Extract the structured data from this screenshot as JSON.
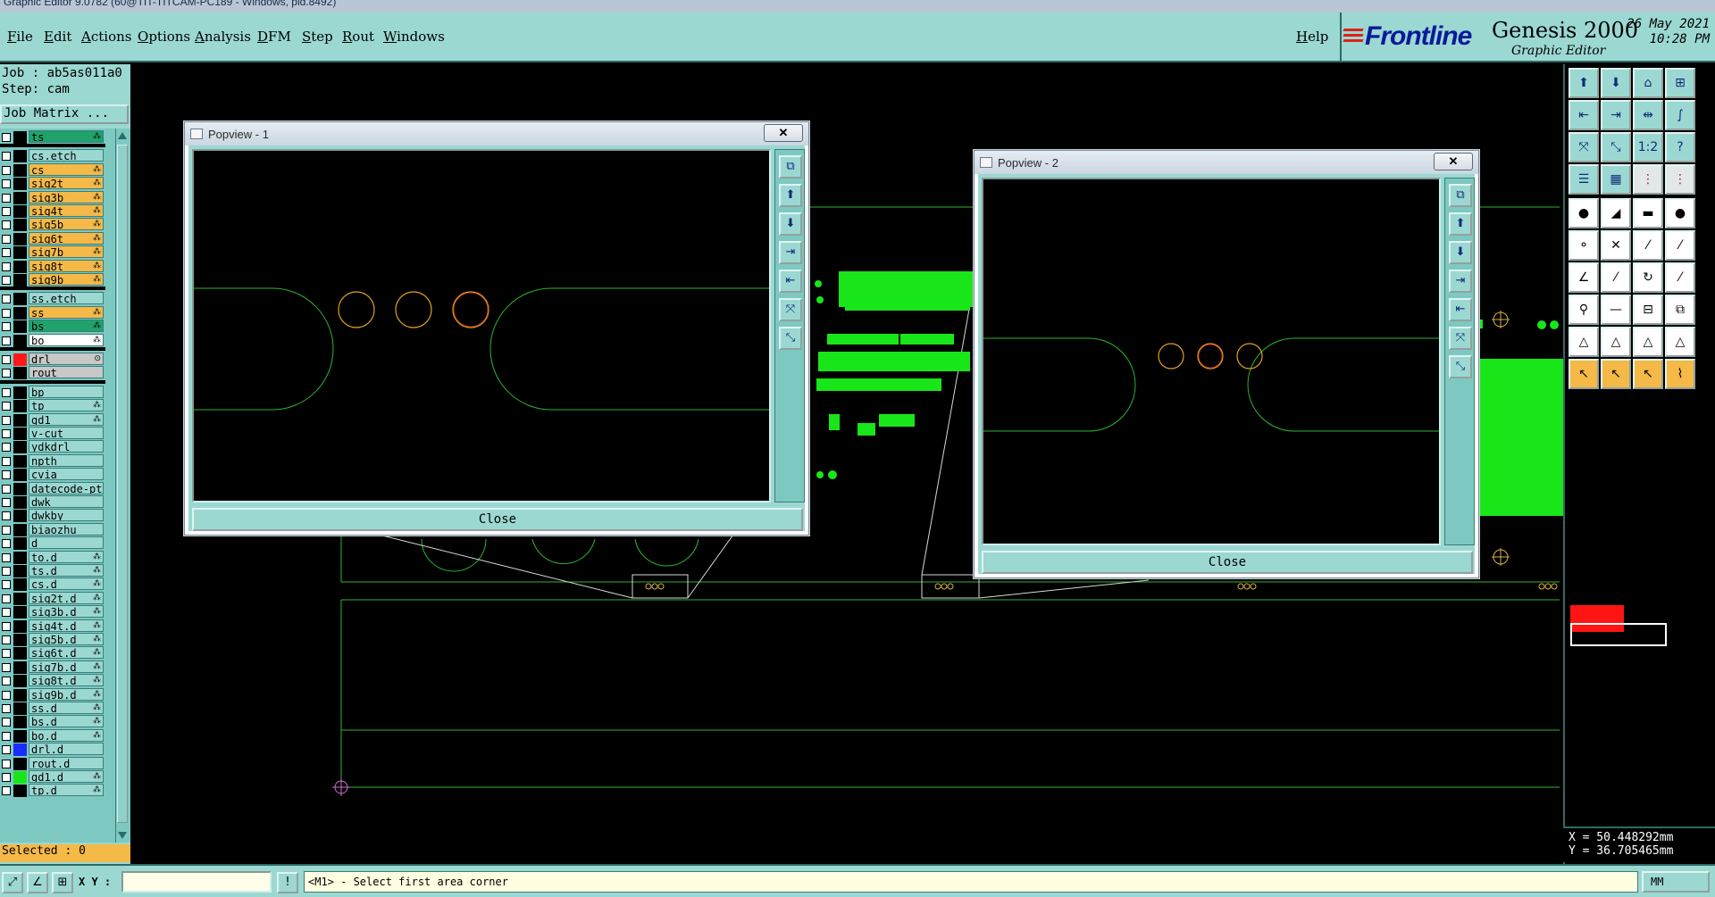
{
  "window_title": "Graphic Editor 9.0782 (60@TIT-TITCAM-PC189 - Windows, pid.8492)",
  "menu": {
    "items": [
      "File",
      "Edit",
      "Actions",
      "Options",
      "Analysis",
      "DFM",
      "Step",
      "Rout",
      "Windows"
    ],
    "help": "Help"
  },
  "brand": {
    "logo": "Frontline",
    "product": "Genesis 2000",
    "subtitle": "Graphic Editor",
    "date": "26 May 2021",
    "time": "10:28 PM"
  },
  "left_panel": {
    "job": "Job : ab5as011a0",
    "step": "Step: cam",
    "job_matrix": "Job Matrix ...",
    "layers": [
      {
        "name": "ts",
        "color": "#000000",
        "bg": "#1fa36a",
        "flag": "⁂"
      },
      {
        "name": "cs.etch",
        "color": "#000000",
        "bg": "#9cd8d2",
        "flag": "",
        "section": true
      },
      {
        "name": "cs",
        "color": "#000000",
        "bg": "#f5b948",
        "flag": "⁂"
      },
      {
        "name": "sig2t",
        "color": "#000000",
        "bg": "#f5b948",
        "flag": "⁂"
      },
      {
        "name": "sig3b",
        "color": "#000000",
        "bg": "#f5b948",
        "flag": "⁂"
      },
      {
        "name": "sig4t",
        "color": "#000000",
        "bg": "#f5b948",
        "flag": "⁂"
      },
      {
        "name": "sig5b",
        "color": "#000000",
        "bg": "#f5b948",
        "flag": "⁂"
      },
      {
        "name": "sig6t",
        "color": "#000000",
        "bg": "#f5b948",
        "flag": "⁂"
      },
      {
        "name": "sig7b",
        "color": "#000000",
        "bg": "#f5b948",
        "flag": "⁂"
      },
      {
        "name": "sig8t",
        "color": "#000000",
        "bg": "#f5b948",
        "flag": "⁂"
      },
      {
        "name": "sig9b",
        "color": "#000000",
        "bg": "#f5b948",
        "flag": "⁂"
      },
      {
        "name": "ss.etch",
        "color": "#000000",
        "bg": "#9cd8d2",
        "flag": "",
        "section": true
      },
      {
        "name": "ss",
        "color": "#000000",
        "bg": "#f5b948",
        "flag": "⁂"
      },
      {
        "name": "bs",
        "color": "#000000",
        "bg": "#1fa36a",
        "flag": "⁂"
      },
      {
        "name": "bo",
        "color": "#000000",
        "bg": "#ffffff",
        "flag": "⁂"
      },
      {
        "name": "drl",
        "color": "#ff1a1a",
        "bg": "#c8c8c8",
        "flag": "⊙",
        "section": true
      },
      {
        "name": "rout",
        "color": "#000000",
        "bg": "#c8c8c8",
        "flag": ""
      },
      {
        "name": "bp",
        "color": "#000000",
        "bg": "#9cd8d2",
        "flag": "",
        "section": true
      },
      {
        "name": "tp",
        "color": "#000000",
        "bg": "#9cd8d2",
        "flag": "⁂"
      },
      {
        "name": "gd1",
        "color": "#000000",
        "bg": "#9cd8d2",
        "flag": "⁂"
      },
      {
        "name": "v-cut",
        "color": "#000000",
        "bg": "#9cd8d2",
        "flag": ""
      },
      {
        "name": "ydkdrl",
        "color": "#000000",
        "bg": "#9cd8d2",
        "flag": ""
      },
      {
        "name": "npth",
        "color": "#000000",
        "bg": "#9cd8d2",
        "flag": ""
      },
      {
        "name": "cvia",
        "color": "#000000",
        "bg": "#9cd8d2",
        "flag": ""
      },
      {
        "name": "datecode-pt",
        "color": "#000000",
        "bg": "#9cd8d2",
        "flag": ""
      },
      {
        "name": "dwk",
        "color": "#000000",
        "bg": "#9cd8d2",
        "flag": ""
      },
      {
        "name": "dwkby",
        "color": "#000000",
        "bg": "#9cd8d2",
        "flag": ""
      },
      {
        "name": "biaozhu",
        "color": "#000000",
        "bg": "#9cd8d2",
        "flag": ""
      },
      {
        "name": "d",
        "color": "#000000",
        "bg": "#9cd8d2",
        "flag": ""
      },
      {
        "name": "to.d",
        "color": "#000000",
        "bg": "#9cd8d2",
        "flag": "⁂"
      },
      {
        "name": "ts.d",
        "color": "#000000",
        "bg": "#9cd8d2",
        "flag": "⁂"
      },
      {
        "name": "cs.d",
        "color": "#000000",
        "bg": "#9cd8d2",
        "flag": "⁂"
      },
      {
        "name": "sig2t.d",
        "color": "#000000",
        "bg": "#9cd8d2",
        "flag": "⁂"
      },
      {
        "name": "sig3b.d",
        "color": "#000000",
        "bg": "#9cd8d2",
        "flag": "⁂"
      },
      {
        "name": "sig4t.d",
        "color": "#000000",
        "bg": "#9cd8d2",
        "flag": "⁂"
      },
      {
        "name": "sig5b.d",
        "color": "#000000",
        "bg": "#9cd8d2",
        "flag": "⁂"
      },
      {
        "name": "sig6t.d",
        "color": "#000000",
        "bg": "#9cd8d2",
        "flag": "⁂"
      },
      {
        "name": "sig7b.d",
        "color": "#000000",
        "bg": "#9cd8d2",
        "flag": "⁂"
      },
      {
        "name": "sig8t.d",
        "color": "#000000",
        "bg": "#9cd8d2",
        "flag": "⁂"
      },
      {
        "name": "sig9b.d",
        "color": "#000000",
        "bg": "#9cd8d2",
        "flag": "⁂"
      },
      {
        "name": "ss.d",
        "color": "#000000",
        "bg": "#9cd8d2",
        "flag": "⁂"
      },
      {
        "name": "bs.d",
        "color": "#000000",
        "bg": "#9cd8d2",
        "flag": "⁂"
      },
      {
        "name": "bo.d",
        "color": "#000000",
        "bg": "#9cd8d2",
        "flag": "⁂"
      },
      {
        "name": "drl.d",
        "color": "#1a2cff",
        "bg": "#9cd8d2",
        "flag": ""
      },
      {
        "name": "rout.d",
        "color": "#000000",
        "bg": "#9cd8d2",
        "flag": ""
      },
      {
        "name": "gd1.d",
        "color": "#19e619",
        "bg": "#9cd8d2",
        "flag": "⁂"
      },
      {
        "name": "tp.d",
        "color": "#000000",
        "bg": "#9cd8d2",
        "flag": "⁂"
      }
    ],
    "selected": "Selected : 0"
  },
  "popview1": {
    "title": "Popview - 1",
    "close_x": "✕",
    "close_btn": "Close",
    "tools": [
      "⧉",
      "⬆",
      "⬇",
      "⇥",
      "⇤",
      "⤧",
      "⤡"
    ]
  },
  "popview2": {
    "title": "Popview - 2",
    "close_x": "✕",
    "close_btn": "Close",
    "tools": [
      "⧉",
      "⬆",
      "⬇",
      "⇥",
      "⇤",
      "⤧",
      "⤡"
    ]
  },
  "toolbar": {
    "rows": [
      [
        {
          "glyph": "⬆",
          "kind": "cyan",
          "icon": "zoom-home-icon"
        },
        {
          "glyph": "⬇",
          "kind": "cyan",
          "icon": "zoom-back-icon"
        },
        {
          "glyph": "⌂",
          "kind": "cyan",
          "icon": "home-icon"
        },
        {
          "glyph": "⊞",
          "kind": "cyan",
          "icon": "window-icon"
        }
      ],
      [
        {
          "glyph": "⇤",
          "kind": "cyan",
          "icon": "pan-left-icon"
        },
        {
          "glyph": "⇥",
          "kind": "cyan",
          "icon": "pan-right-icon"
        },
        {
          "glyph": "⇹",
          "kind": "cyan",
          "icon": "pan-icon"
        },
        {
          "glyph": "∫",
          "kind": "cyan",
          "icon": "curve-icon"
        }
      ],
      [
        {
          "glyph": "⤧",
          "kind": "cyan",
          "icon": "zoom-in-icon"
        },
        {
          "glyph": "⤡",
          "kind": "cyan",
          "icon": "zoom-out-icon"
        },
        {
          "glyph": "1:2",
          "kind": "cyan",
          "icon": "scale-icon"
        },
        {
          "glyph": "?",
          "kind": "cyan",
          "icon": "help-icon"
        }
      ],
      [
        {
          "glyph": "☰",
          "kind": "cyan",
          "icon": "settings-icon"
        },
        {
          "glyph": "▦",
          "kind": "cyan",
          "icon": "grid-icon"
        },
        {
          "glyph": "⋮",
          "kind": "red",
          "icon": "net-icon"
        },
        {
          "glyph": "⋮",
          "kind": "red",
          "icon": "net-alt-icon"
        }
      ],
      [
        {
          "glyph": "●",
          "kind": "white",
          "icon": "pad-add-icon"
        },
        {
          "glyph": "◢",
          "kind": "white",
          "icon": "surface-icon"
        },
        {
          "glyph": "▬",
          "kind": "white",
          "icon": "line-icon"
        },
        {
          "glyph": "●",
          "kind": "white",
          "icon": "pad-icon"
        }
      ],
      [
        {
          "glyph": "⚬",
          "kind": "white",
          "icon": "connect-icon"
        },
        {
          "glyph": "✕",
          "kind": "white",
          "icon": "delete-icon"
        },
        {
          "glyph": "⁄",
          "kind": "white",
          "icon": "slash-icon"
        },
        {
          "glyph": "⁄",
          "kind": "white",
          "icon": "slash-alt-icon"
        }
      ],
      [
        {
          "glyph": "∠",
          "kind": "white",
          "icon": "angle-icon"
        },
        {
          "glyph": "⁄",
          "kind": "white",
          "icon": "diagonal-icon"
        },
        {
          "glyph": "↻",
          "kind": "white",
          "icon": "rotate-icon"
        },
        {
          "glyph": "⁄",
          "kind": "white",
          "icon": "arc-icon"
        }
      ],
      [
        {
          "glyph": "⚲",
          "kind": "white",
          "icon": "probe-icon"
        },
        {
          "glyph": "—",
          "kind": "white",
          "icon": "measure-icon"
        },
        {
          "glyph": "⊟",
          "kind": "white",
          "icon": "snap-icon"
        },
        {
          "glyph": "⧉",
          "kind": "white",
          "icon": "copy-icon"
        }
      ],
      [
        {
          "glyph": "△",
          "kind": "white",
          "icon": "polygon-icon"
        },
        {
          "glyph": "△",
          "kind": "white",
          "icon": "polygon-alt-icon"
        },
        {
          "glyph": "△",
          "kind": "white",
          "icon": "triangle-icon"
        },
        {
          "glyph": "△",
          "kind": "white",
          "icon": "triangle-alt-icon"
        }
      ],
      [
        {
          "glyph": "↖",
          "kind": "orange",
          "icon": "select-icon"
        },
        {
          "glyph": "↖",
          "kind": "orange",
          "icon": "select-alt-icon"
        },
        {
          "glyph": "↖",
          "kind": "orange",
          "icon": "select-net-icon"
        },
        {
          "glyph": "⌇",
          "kind": "orange",
          "icon": "route-icon"
        }
      ]
    ]
  },
  "coords": {
    "x": "X = 50.448292mm",
    "y": "Y = 36.705465mm"
  },
  "status": {
    "xy_label": "X Y :",
    "xy_value": "",
    "prompt": "<M1> - Select first area corner",
    "units": "MM"
  }
}
